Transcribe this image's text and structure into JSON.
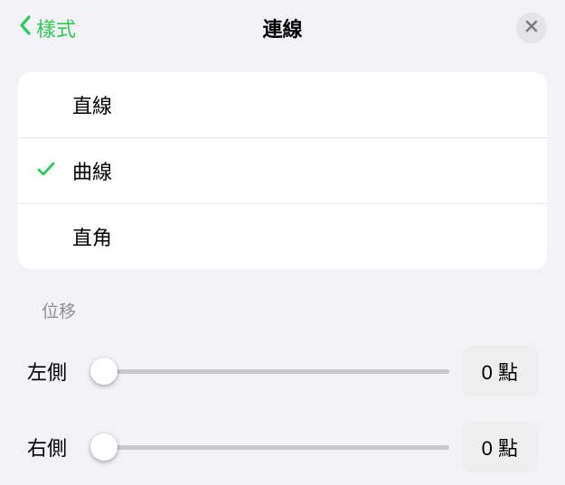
{
  "header": {
    "back_label": "樣式",
    "title": "連線"
  },
  "line_types": {
    "items": [
      {
        "label": "直線",
        "selected": false
      },
      {
        "label": "曲線",
        "selected": true
      },
      {
        "label": "直角",
        "selected": false
      }
    ]
  },
  "offset": {
    "section_label": "位移",
    "left": {
      "label": "左側",
      "value_display": "0 點",
      "value": 0
    },
    "right": {
      "label": "右側",
      "value_display": "0 點",
      "value": 0
    }
  },
  "colors": {
    "accent": "#34c759"
  }
}
